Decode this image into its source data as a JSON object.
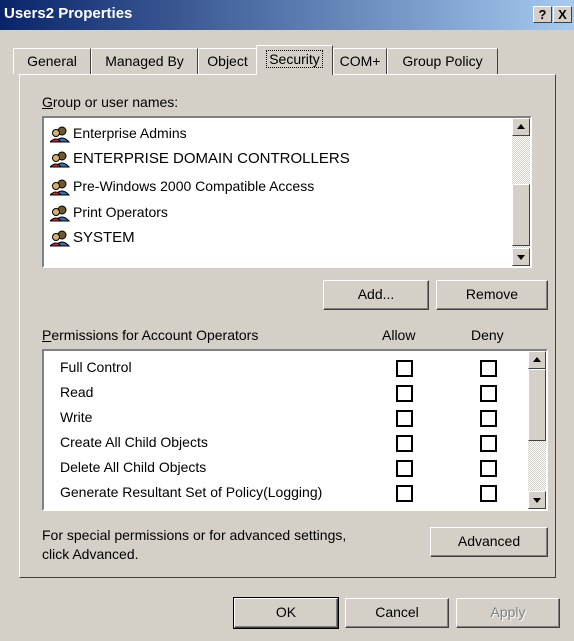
{
  "window": {
    "title": "Users2 Properties",
    "help_btn": "?",
    "close_btn": "X"
  },
  "tabs": [
    "General",
    "Managed By",
    "Object",
    "Security",
    "COM+",
    "Group Policy"
  ],
  "groups": {
    "label_prefix": "",
    "label_u": "G",
    "label_rest": "roup or user names:",
    "items": [
      "Enterprise Admins",
      "ENTERPRISE DOMAIN CONTROLLERS",
      "Pre-Windows 2000 Compatible Access",
      "Print Operators",
      "SYSTEM"
    ]
  },
  "buttons": {
    "add": "Add...",
    "remove": "Remove",
    "advanced": "Advanced",
    "ok": "OK",
    "cancel": "Cancel",
    "apply": "Apply"
  },
  "permissions": {
    "label_u": "P",
    "label_rest": "ermissions for Account Operators",
    "allow_header": "Allow",
    "deny_header": "Deny",
    "rows": [
      "Full Control",
      "Read",
      "Write",
      "Create All Child Objects",
      "Delete All Child Objects",
      "Generate Resultant Set of Policy(Logging)"
    ]
  },
  "advanced_note": {
    "line1": "For special permissions or for advanced settings,",
    "line2": "click Advanced."
  },
  "colors": {
    "titlebar_start": "#0a246a",
    "titlebar_end": "#a6caf0",
    "face": "#d4d0c8"
  }
}
